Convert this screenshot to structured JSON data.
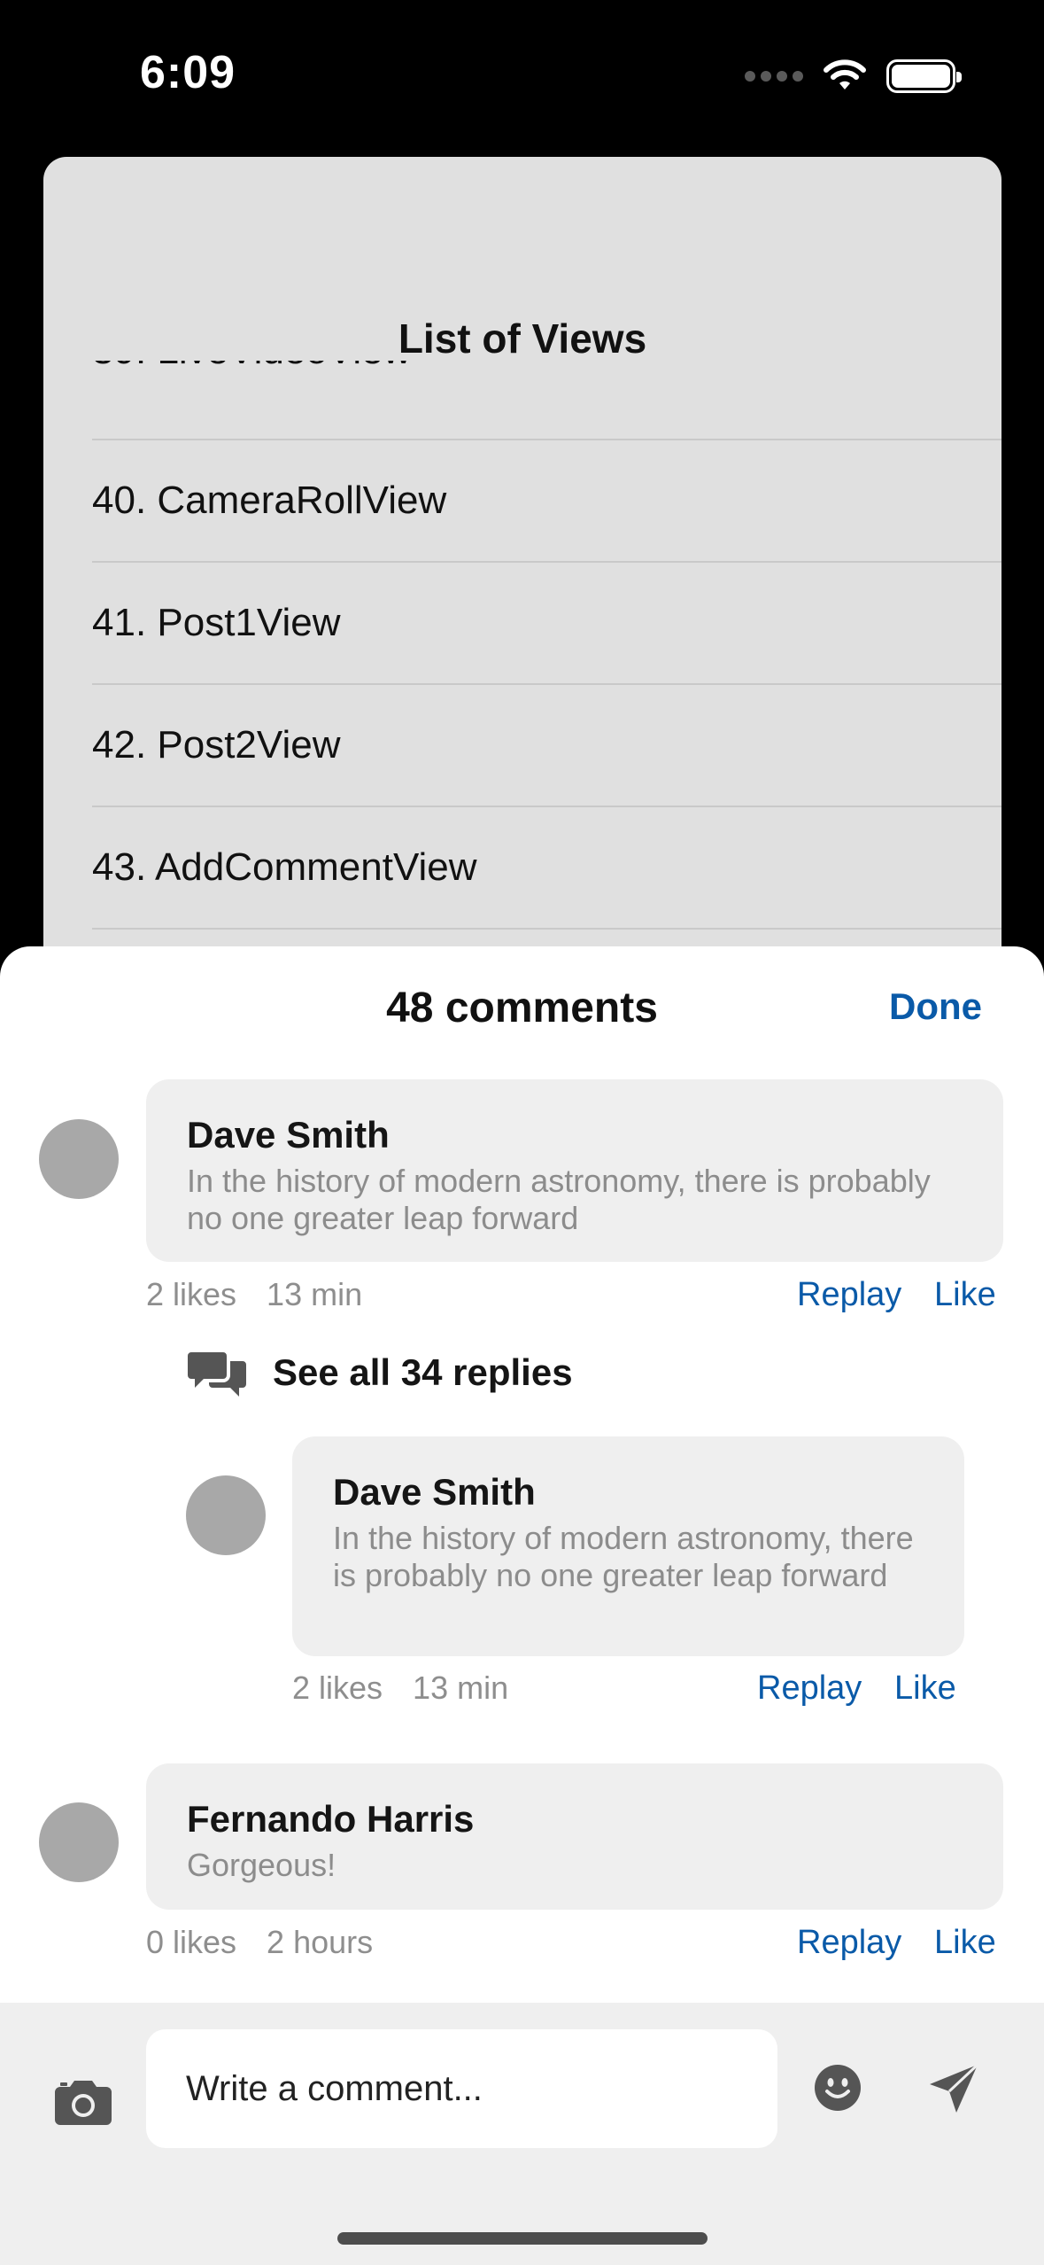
{
  "status_bar": {
    "time": "6:09"
  },
  "background_sheet": {
    "title": "List of Views",
    "partial_item": "39. LiveVideoView",
    "items": [
      "40. CameraRollView",
      "41. Post1View",
      "42. Post2View",
      "43. AddCommentView"
    ]
  },
  "comments_sheet": {
    "title": "48 comments",
    "done_label": "Done",
    "comments": [
      {
        "author": "Dave Smith",
        "text": "In the history of modern astronomy, there is probably no one greater leap forward",
        "likes": "2 likes",
        "time": "13 min",
        "reply_label": "Replay",
        "like_label": "Like"
      },
      {
        "author": "Fernando Harris",
        "text": "Gorgeous!",
        "likes": "0 likes",
        "time": "2 hours",
        "reply_label": "Replay",
        "like_label": "Like"
      }
    ],
    "see_replies_label": "See all 34 replies",
    "reply": {
      "author": "Dave Smith",
      "text": "In the history of modern astronomy, there is probably no one greater leap forward",
      "likes": "2 likes",
      "time": "13 min",
      "reply_label": "Replay",
      "like_label": "Like"
    }
  },
  "input_bar": {
    "placeholder": "Write a comment...",
    "icons": [
      "camera-icon",
      "emoji-icon",
      "send-icon"
    ]
  },
  "colors": {
    "accent": "#0a5aa8",
    "avatar": "#a8a8a8",
    "bubble": "#efefef",
    "back_sheet": "#e0e0e0"
  }
}
